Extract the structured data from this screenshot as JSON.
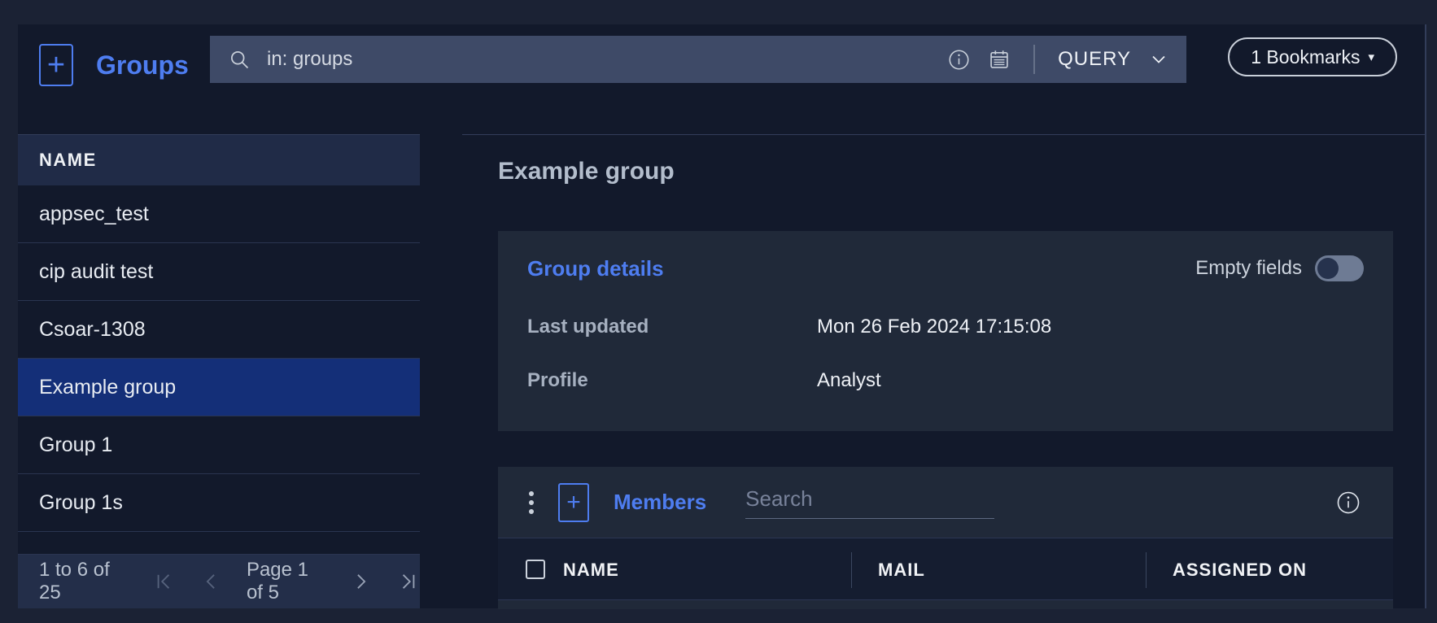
{
  "colors": {
    "accent_blue": "#4e7df0",
    "selected_row_blue": "#142f78",
    "app_background": "#12192b",
    "panel_background": "#202939",
    "search_bar_background": "#3e4a67"
  },
  "header": {
    "add_group_button": "+",
    "title": "Groups",
    "search_value": "in: groups",
    "query_label": "QUERY",
    "bookmarks_label": "1 Bookmarks"
  },
  "group_list": {
    "column_header": "NAME",
    "rows": [
      {
        "name": "appsec_test",
        "selected": false
      },
      {
        "name": "cip audit test",
        "selected": false
      },
      {
        "name": "Csoar-1308",
        "selected": false
      },
      {
        "name": "Example group",
        "selected": true
      },
      {
        "name": "Group 1",
        "selected": false
      },
      {
        "name": "Group 1s",
        "selected": false
      }
    ],
    "pagination": {
      "range_label": "1 to 6 of 25",
      "page_label": "Page 1 of 5"
    }
  },
  "detail": {
    "heading": "Example group",
    "group_details": {
      "title": "Group details",
      "empty_fields_label": "Empty fields",
      "empty_fields_enabled": false,
      "fields": [
        {
          "label": "Last updated",
          "value": "Mon 26 Feb 2024 17:15:08"
        },
        {
          "label": "Profile",
          "value": "Analyst"
        }
      ]
    },
    "members": {
      "add_member_button": "+",
      "title": "Members",
      "search_placeholder": "Search",
      "columns": [
        "NAME",
        "MAIL",
        "ASSIGNED ON"
      ]
    }
  }
}
